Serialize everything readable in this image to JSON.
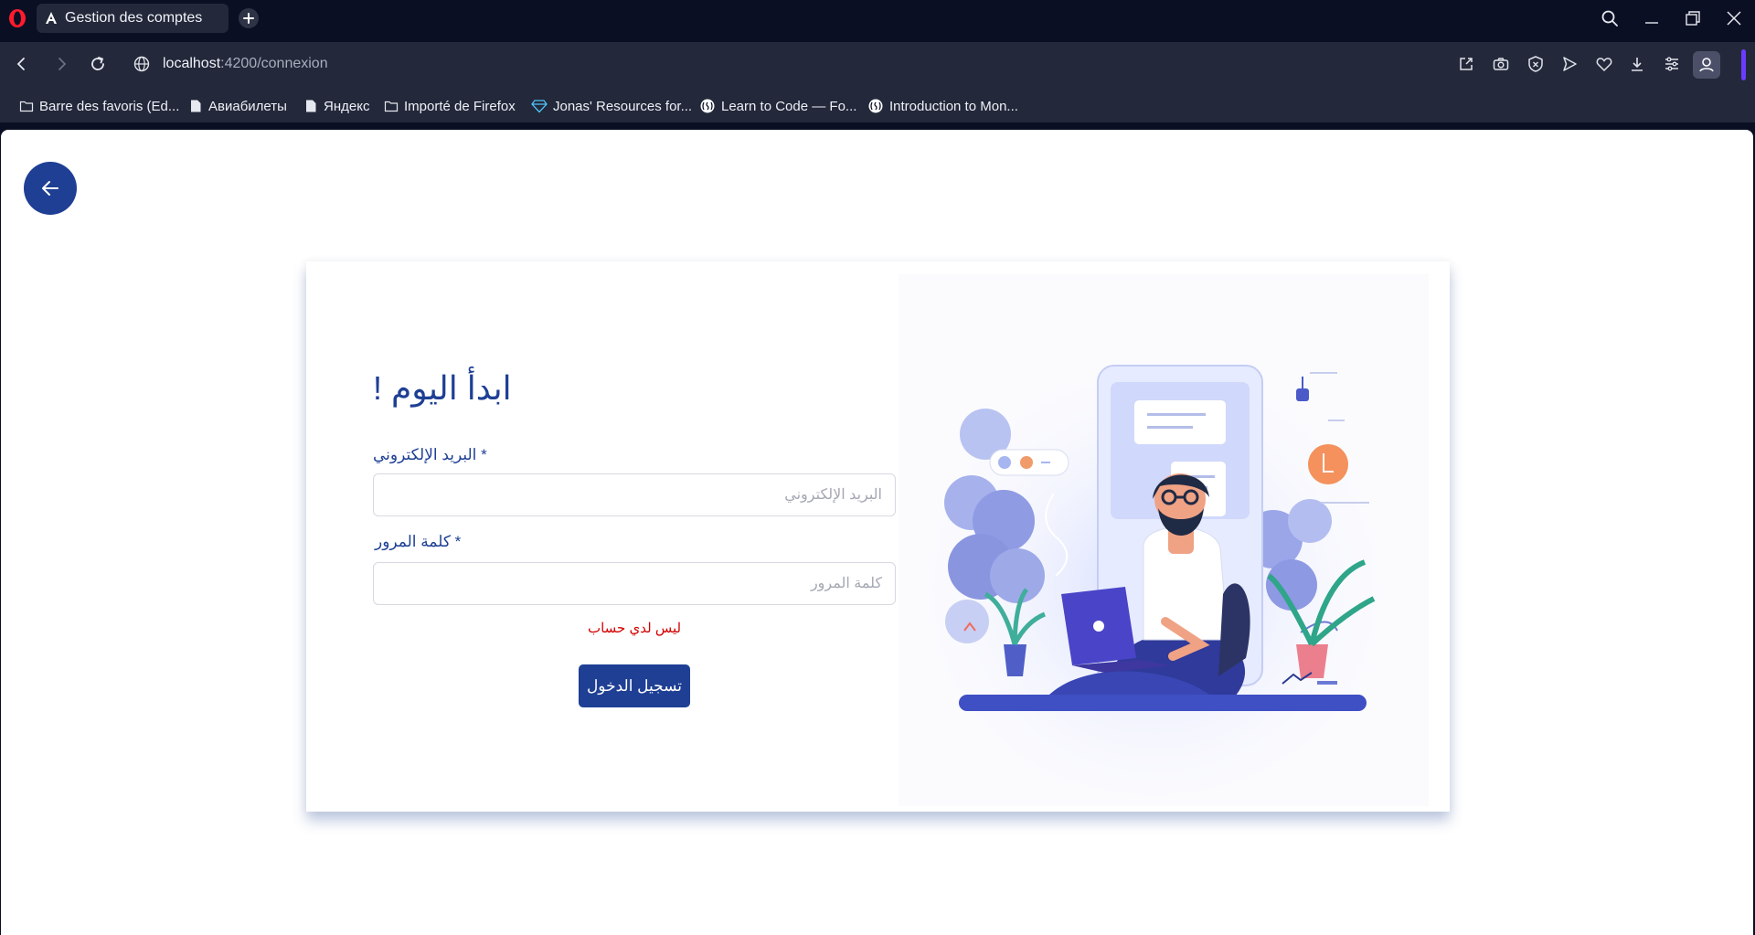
{
  "browser": {
    "tab_title": "Gestion des comptes",
    "url_host": "localhost",
    "url_path": ":4200/connexion",
    "bookmarks": [
      {
        "label": "Barre des favoris (Ed...",
        "icon": "folder-icon"
      },
      {
        "label": "Авиабилеты",
        "icon": "page-icon"
      },
      {
        "label": "Яндекс",
        "icon": "page-icon"
      },
      {
        "label": "Importé de Firefox",
        "icon": "folder-icon"
      },
      {
        "label": "Jonas' Resources for...",
        "icon": "diamond-icon"
      },
      {
        "label": "Learn to Code — Fo...",
        "icon": "freecodecamp-icon"
      },
      {
        "label": "Introduction to Mon...",
        "icon": "freecodecamp-icon"
      }
    ]
  },
  "login": {
    "title": "ابدأ اليوم !",
    "email_label": "* البريد الإلكتروني",
    "email_placeholder": "البريد الإلكتروني",
    "email_value": "",
    "password_label": "* كلمة المرور",
    "password_placeholder": "كلمة المرور",
    "password_value": "",
    "no_account_link": "ليس لدي حساب",
    "submit_label": "تسجيل الدخول"
  },
  "colors": {
    "primary": "#1e3f94",
    "error_link": "#d40000",
    "browser_chrome": "#23283a",
    "browser_dark": "#0b0f24"
  }
}
